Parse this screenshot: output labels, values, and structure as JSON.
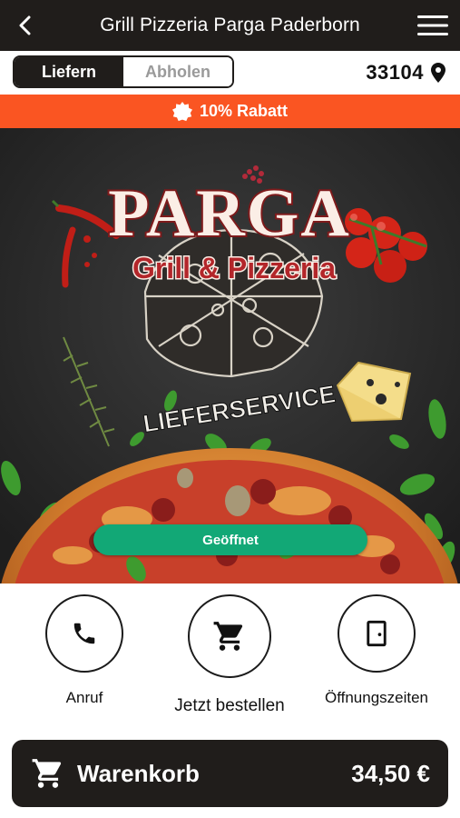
{
  "header": {
    "title": "Grill Pizzeria Parga Paderborn",
    "back_icon": "chevron-left-icon",
    "menu_icon": "hamburger-menu-icon"
  },
  "mode_toggle": {
    "options": [
      "Liefern",
      "Abholen"
    ],
    "selected": "Liefern"
  },
  "location": {
    "postcode": "33104",
    "icon": "map-pin-icon"
  },
  "promo": {
    "icon": "badge-icon",
    "text": "10% Rabatt",
    "color": "#fa5522"
  },
  "hero": {
    "logo_title": "PARGA",
    "logo_subtitle": "Grill & Pizzeria",
    "tagline": "LIEFERSERVICE",
    "status_label": "Geöffnet",
    "status_color": "#12a876"
  },
  "actions": [
    {
      "label": "Anruf",
      "icon": "phone-icon"
    },
    {
      "label": "Jetzt bestellen",
      "icon": "shopping-cart-icon"
    },
    {
      "label": "Öffnungszeiten",
      "icon": "door-icon"
    }
  ],
  "cart": {
    "label": "Warenkorb",
    "total": "34,50 €",
    "icon": "shopping-cart-icon"
  },
  "colors": {
    "dark": "#201d1b",
    "accent": "#fa5522",
    "open_green": "#12a876"
  }
}
